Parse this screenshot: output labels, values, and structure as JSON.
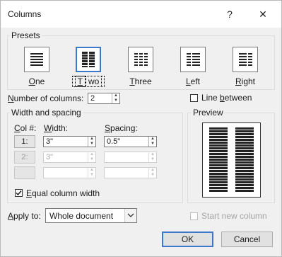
{
  "window": {
    "title": "Columns",
    "help_label": "?",
    "close_label": "✕"
  },
  "presets": {
    "group_label": "Presets",
    "items": [
      {
        "id": "one",
        "label": "One",
        "underline": "O",
        "rest": "ne",
        "selected": false
      },
      {
        "id": "two",
        "label": "Two",
        "underline": "T",
        "rest": "wo",
        "selected": true
      },
      {
        "id": "three",
        "label": "Three",
        "underline": "T",
        "rest": "hree",
        "selected": false
      },
      {
        "id": "left",
        "label": "Left",
        "underline": "L",
        "rest": "eft",
        "selected": false
      },
      {
        "id": "right",
        "label": "Right",
        "underline": "R",
        "rest": "ight",
        "selected": false
      }
    ]
  },
  "number_of_columns": {
    "label_pre": "N",
    "label_rest": "umber of columns:",
    "value": "2"
  },
  "line_between": {
    "label_pre": "Line ",
    "label_u": "b",
    "label_rest": "etween",
    "checked": false
  },
  "width_spacing": {
    "group_label": "Width and spacing",
    "col_header_u": "C",
    "col_header_rest": "ol #:",
    "width_header_u": "W",
    "width_header_rest": "idth:",
    "spacing_header_u": "S",
    "spacing_header_rest": "pacing:",
    "rows": [
      {
        "col": "1:",
        "width": "3\"",
        "spacing": "0.5\"",
        "enabled": true
      },
      {
        "col": "2:",
        "width": "3\"",
        "spacing": "",
        "enabled": false
      },
      {
        "col": "",
        "width": "",
        "spacing": "",
        "enabled": false
      }
    ]
  },
  "equal_width": {
    "label_u": "E",
    "label_rest": "qual column width",
    "checked": true
  },
  "preview": {
    "group_label": "Preview",
    "columns": 2
  },
  "apply_to": {
    "label_pre": "",
    "label_u": "A",
    "label_rest": "pply to:",
    "value": "Whole document"
  },
  "start_new_column": {
    "label": "Start new column",
    "checked": false,
    "enabled": false
  },
  "buttons": {
    "ok": "OK",
    "cancel": "Cancel"
  }
}
